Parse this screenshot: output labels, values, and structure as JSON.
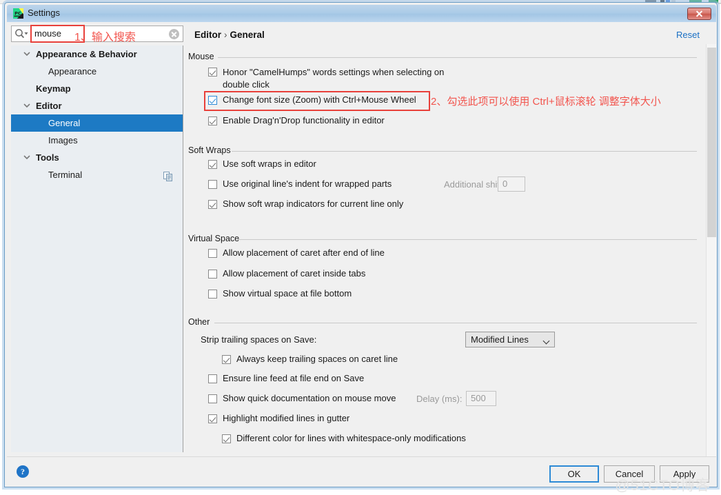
{
  "window": {
    "title": "Settings",
    "app_icon": "pycharm-icon",
    "close_label": "Close"
  },
  "search": {
    "value": "mouse",
    "placeholder": "",
    "magnifier_icon": "search-icon",
    "clear_icon": "clear-icon"
  },
  "annotations": [
    {
      "id": "annot-1",
      "text": "1、输入搜索",
      "color": "#f2554e"
    },
    {
      "id": "annot-2",
      "text": "2、勾选此项可以使用 Ctrl+鼠标滚轮 调整字体大小",
      "color": "#f2554e"
    }
  ],
  "sidebar": {
    "items": [
      {
        "label": "Appearance & Behavior",
        "level": 0,
        "expanded": true,
        "selected": false,
        "icon": "chevron-down-icon"
      },
      {
        "label": "Appearance",
        "level": 1,
        "expanded": null,
        "selected": false,
        "icon": ""
      },
      {
        "label": "Keymap",
        "level": 0,
        "expanded": null,
        "selected": false,
        "icon": ""
      },
      {
        "label": "Editor",
        "level": 0,
        "expanded": true,
        "selected": false,
        "icon": "chevron-down-icon"
      },
      {
        "label": "General",
        "level": 1,
        "expanded": null,
        "selected": true,
        "icon": ""
      },
      {
        "label": "Images",
        "level": 1,
        "expanded": null,
        "selected": false,
        "icon": ""
      },
      {
        "label": "Tools",
        "level": 0,
        "expanded": true,
        "selected": false,
        "icon": "chevron-down-icon"
      },
      {
        "label": "Terminal",
        "level": 1,
        "expanded": null,
        "selected": false,
        "icon": "",
        "row_icon": "copy-settings-icon"
      }
    ]
  },
  "content": {
    "breadcrumb_root": "Editor",
    "breadcrumb_sep": "›",
    "breadcrumb_leaf": "General",
    "reset_label": "Reset",
    "groups": [
      {
        "title": "Mouse",
        "rows": [
          {
            "type": "checkbox",
            "label": "Honor \"CamelHumps\" words settings when selecting on double click",
            "checked": true,
            "focused": false,
            "enabled": true,
            "wrap": true
          },
          {
            "type": "checkbox",
            "label": "Change font size (Zoom) with Ctrl+Mouse Wheel",
            "checked": true,
            "focused": true,
            "enabled": true,
            "wrap": false
          },
          {
            "type": "checkbox",
            "label": "Enable Drag'n'Drop functionality in editor",
            "checked": true,
            "focused": false,
            "enabled": true,
            "wrap": false
          }
        ]
      },
      {
        "title": "Soft Wraps",
        "rows": [
          {
            "type": "checkbox",
            "label": "Use soft wraps in editor",
            "checked": true,
            "focused": false,
            "enabled": true,
            "wrap": false
          },
          {
            "type": "checkbox",
            "label": "Use original line's indent for wrapped parts",
            "checked": false,
            "focused": false,
            "enabled": true,
            "wrap": false
          },
          {
            "type": "checkbox",
            "label": "Show soft wrap indicators for current line only",
            "checked": true,
            "focused": false,
            "enabled": true,
            "wrap": false
          }
        ],
        "field": {
          "label": "Additional shift:",
          "value": "0",
          "enabled": false
        }
      },
      {
        "title": "Virtual Space",
        "rows": [
          {
            "type": "checkbox",
            "label": "Allow placement of caret after end of line",
            "checked": false,
            "focused": false,
            "enabled": true,
            "wrap": false
          },
          {
            "type": "checkbox",
            "label": "Allow placement of caret inside tabs",
            "checked": false,
            "focused": false,
            "enabled": true,
            "wrap": false
          },
          {
            "type": "checkbox",
            "label": "Show virtual space at file bottom",
            "checked": false,
            "focused": false,
            "enabled": true,
            "wrap": false
          }
        ]
      },
      {
        "title": "Other",
        "strip_label": "Strip trailing spaces on Save:",
        "strip_value": "Modified Lines",
        "rows": [
          {
            "type": "checkbox",
            "label": "Always keep trailing spaces on caret line",
            "checked": true,
            "focused": false,
            "enabled": true,
            "indent": true
          },
          {
            "type": "checkbox",
            "label": "Ensure line feed at file end on Save",
            "checked": false,
            "focused": false,
            "enabled": true,
            "indent": false
          },
          {
            "type": "checkbox",
            "label": "Show quick documentation on mouse move",
            "checked": false,
            "focused": false,
            "enabled": true,
            "indent": false
          },
          {
            "type": "checkbox",
            "label": "Highlight modified lines in gutter",
            "checked": true,
            "focused": false,
            "enabled": true,
            "indent": false
          },
          {
            "type": "checkbox",
            "label": "Different color for lines with whitespace-only modifications",
            "checked": true,
            "focused": false,
            "enabled": true,
            "indent": true
          }
        ],
        "delay": {
          "label": "Delay (ms):",
          "value": "500",
          "enabled": false
        }
      }
    ]
  },
  "footer": {
    "help_icon": "help-icon",
    "help_glyph": "?",
    "ok_label": "OK",
    "cancel_label": "Cancel",
    "apply_label": "Apply",
    "watermark": "@51CTO博客"
  },
  "scrollbar": {
    "name": "vertical-scrollbar"
  }
}
